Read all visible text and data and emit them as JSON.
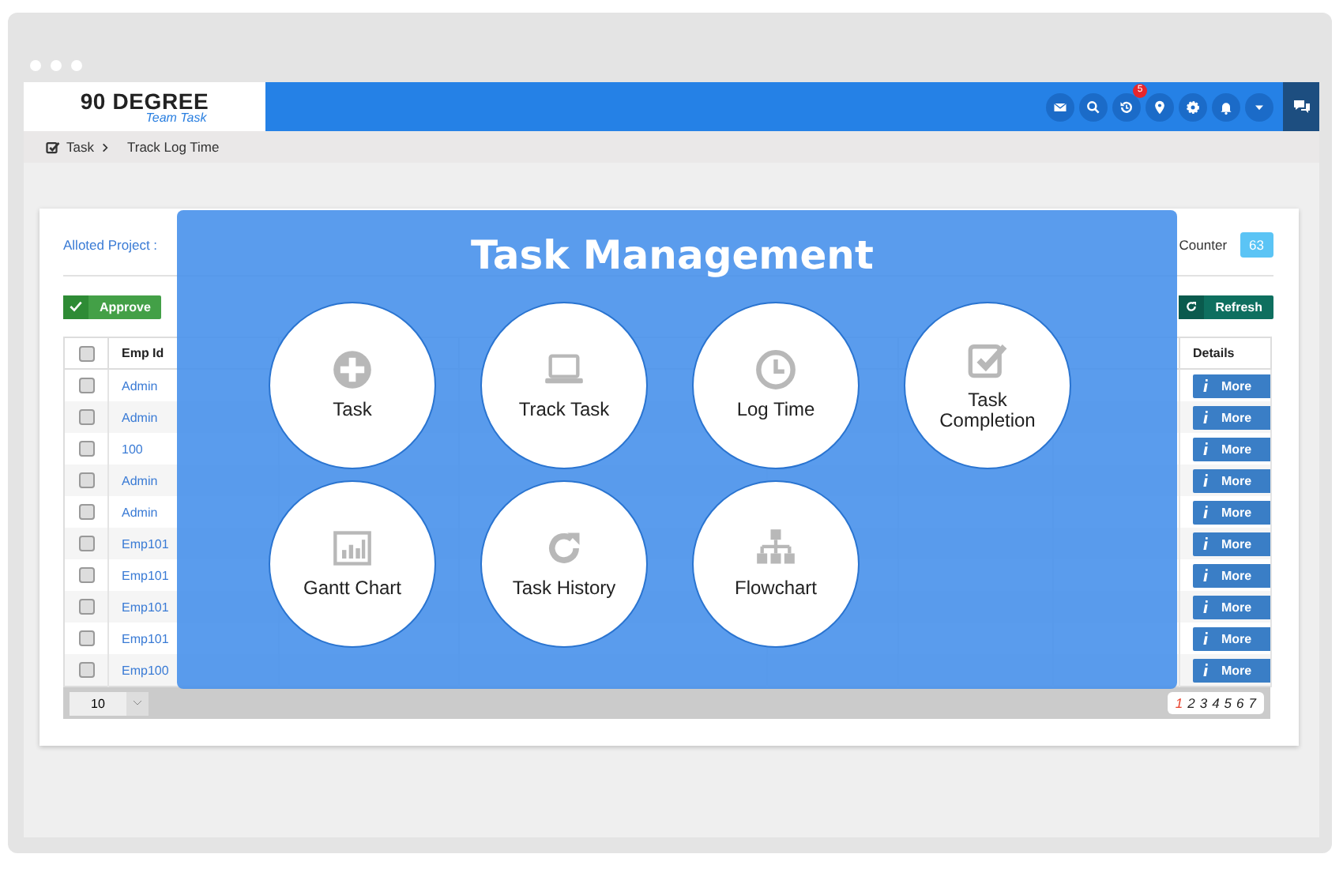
{
  "header": {
    "logo": {
      "title": "90 DEGREE",
      "subtitle": "Team Task"
    },
    "notification_badge": "5"
  },
  "breadcrumb": [
    "Task",
    "Track Log Time"
  ],
  "filters": {
    "project_label": "Alloted Project :",
    "counter_label": "Counter",
    "counter": "63"
  },
  "toolbar": {
    "approve": "Approve",
    "refresh": "Refresh"
  },
  "table": {
    "select_all_checked": false,
    "columns": {
      "emp_id": "Emp Id",
      "details": "Details"
    },
    "rows": [
      {
        "checked": false,
        "emp_id": "Admin",
        "action": "More"
      },
      {
        "checked": false,
        "emp_id": "Admin",
        "action": "More"
      },
      {
        "checked": false,
        "emp_id": "100",
        "action": "More"
      },
      {
        "checked": false,
        "emp_id": "Admin",
        "action": "More"
      },
      {
        "checked": false,
        "emp_id": "Admin",
        "action": "More"
      },
      {
        "checked": false,
        "emp_id": "Emp101",
        "action": "More"
      },
      {
        "checked": false,
        "emp_id": "Emp101",
        "action": "More"
      },
      {
        "checked": false,
        "emp_id": "Emp101",
        "action": "More"
      },
      {
        "checked": false,
        "emp_id": "Emp101",
        "action": "More"
      },
      {
        "checked": false,
        "emp_id": "Emp100",
        "action": "More"
      }
    ],
    "page_size": "10",
    "pages": [
      {
        "label": "1",
        "selected": true
      },
      {
        "label": "2",
        "selected": false
      },
      {
        "label": "3",
        "selected": false
      },
      {
        "label": "4",
        "selected": false
      },
      {
        "label": "5",
        "selected": false
      },
      {
        "label": "6",
        "selected": false
      },
      {
        "label": "7",
        "selected": false
      }
    ]
  },
  "overlay": {
    "title": "Task Management",
    "items": [
      {
        "label": "Task",
        "kind": "plus"
      },
      {
        "label": "Track Task",
        "kind": "laptop"
      },
      {
        "label": "Log Time",
        "kind": "clock"
      },
      {
        "label": "Task Completion",
        "kind": "check"
      },
      {
        "label": "Gantt Chart",
        "kind": "chart"
      },
      {
        "label": "Task History",
        "kind": "history"
      },
      {
        "label": "Flowchart",
        "kind": "org"
      }
    ]
  }
}
